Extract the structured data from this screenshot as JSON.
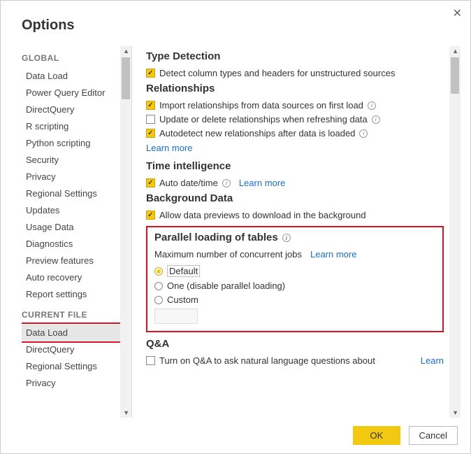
{
  "dialog": {
    "title": "Options",
    "close_aria": "Close"
  },
  "sidebar": {
    "global_header": "GLOBAL",
    "global_items": [
      "Data Load",
      "Power Query Editor",
      "DirectQuery",
      "R scripting",
      "Python scripting",
      "Security",
      "Privacy",
      "Regional Settings",
      "Updates",
      "Usage Data",
      "Diagnostics",
      "Preview features",
      "Auto recovery",
      "Report settings"
    ],
    "current_header": "CURRENT FILE",
    "current_items": [
      "Data Load",
      "DirectQuery",
      "Regional Settings",
      "Privacy"
    ]
  },
  "content": {
    "type_detection": {
      "title": "Type Detection",
      "opt1": "Detect column types and headers for unstructured sources"
    },
    "relationships": {
      "title": "Relationships",
      "opt1": "Import relationships from data sources on first load",
      "opt2": "Update or delete relationships when refreshing data",
      "opt3": "Autodetect new relationships after data is loaded",
      "learn": "Learn more"
    },
    "time_intel": {
      "title": "Time intelligence",
      "opt1": "Auto date/time",
      "learn": "Learn more"
    },
    "background": {
      "title": "Background Data",
      "opt1": "Allow data previews to download in the background"
    },
    "parallel": {
      "title": "Parallel loading of tables",
      "subtitle": "Maximum number of concurrent jobs",
      "learn": "Learn more",
      "opt_default": "Default",
      "opt_one": "One (disable parallel loading)",
      "opt_custom": "Custom"
    },
    "qna": {
      "title": "Q&A",
      "opt1": "Turn on Q&A to ask natural language questions about",
      "learn": "Learn"
    }
  },
  "footer": {
    "ok": "OK",
    "cancel": "Cancel"
  }
}
